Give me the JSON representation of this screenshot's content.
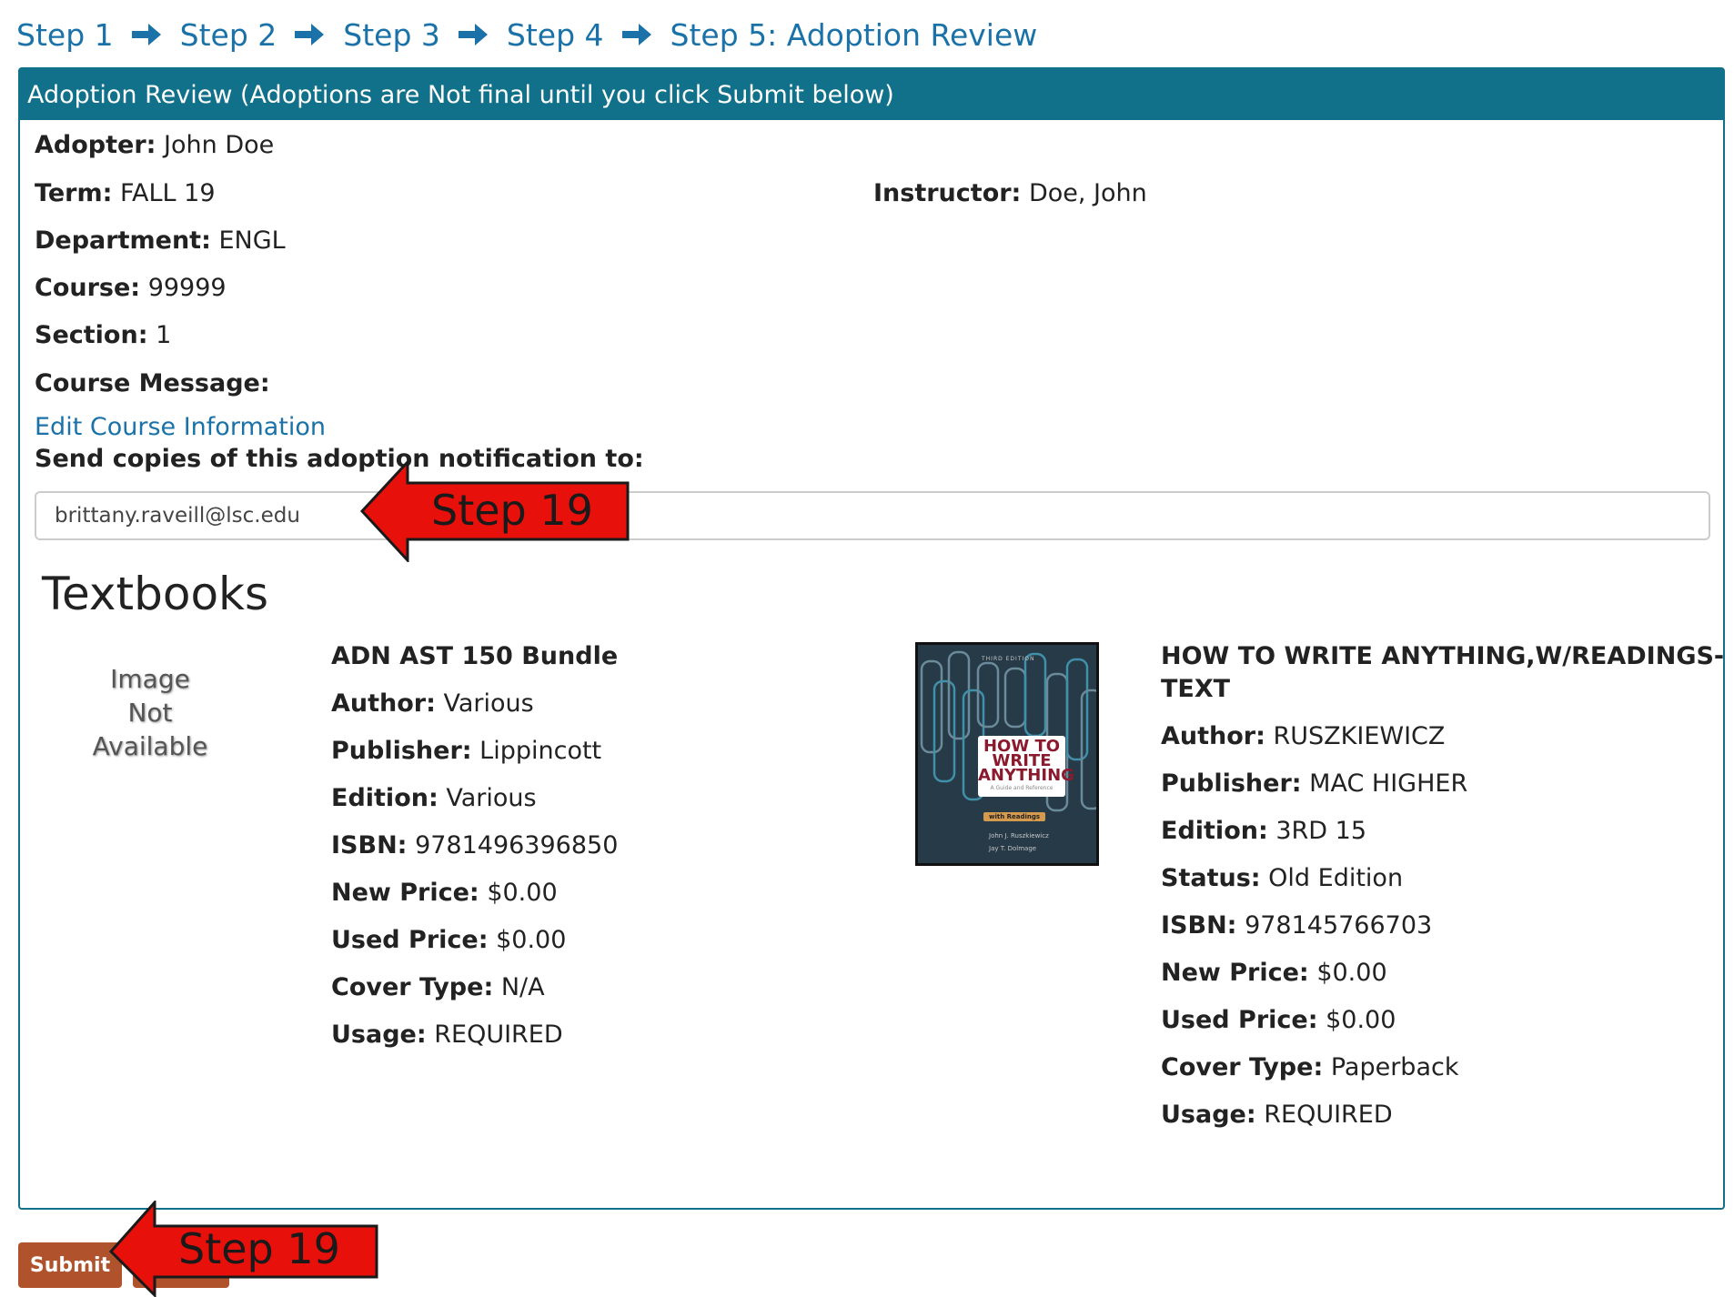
{
  "breadcrumb": {
    "steps": [
      "Step 1",
      "Step 2",
      "Step 3",
      "Step 4",
      "Step 5: Adoption Review"
    ]
  },
  "panel": {
    "heading": "Adoption Review (Adoptions are Not final until you click Submit below)"
  },
  "course": {
    "adopter_label": "Adopter:",
    "adopter": "John Doe",
    "term_label": "Term:",
    "term": "FALL 19",
    "instructor_label": "Instructor:",
    "instructor": "Doe, John",
    "department_label": "Department:",
    "department": "ENGL",
    "course_label": "Course:",
    "course": "99999",
    "section_label": "Section:",
    "section": "1",
    "message_label": "Course Message:",
    "message": "",
    "edit_link": "Edit Course Information"
  },
  "notification": {
    "label": "Send copies of this adoption notification to:",
    "email": "brittany.raveill@lsc.edu"
  },
  "textbooks": {
    "heading": "Textbooks",
    "items": [
      {
        "image_text": [
          "Image",
          "Not",
          "Available"
        ],
        "title": "ADN AST 150 Bundle",
        "fields": [
          {
            "label": "Author:",
            "value": "Various"
          },
          {
            "label": "Publisher:",
            "value": "Lippincott"
          },
          {
            "label": "Edition:",
            "value": "Various"
          },
          {
            "label": "ISBN:",
            "value": "9781496396850"
          },
          {
            "label": "New Price:",
            "value": "$0.00"
          },
          {
            "label": "Used Price:",
            "value": "$0.00"
          },
          {
            "label": "Cover Type:",
            "value": "N/A"
          },
          {
            "label": "Usage:",
            "value": "REQUIRED"
          }
        ]
      },
      {
        "cover": {
          "tag": "THIRD EDITION",
          "title": "HOW TO\nWRITE\nANYTHING",
          "subtitle": "A Guide and Reference",
          "badge": "with Readings",
          "authors": [
            "John J. Ruszkiewicz",
            "Jay T. Dolmage"
          ],
          "bg_color": "#263a48",
          "title_color": "#8b1a2e"
        },
        "title_lines": [
          "HOW TO WRITE ANYTHING,W/READINGS-",
          "TEXT"
        ],
        "fields": [
          {
            "label": "Author:",
            "value": "RUSZKIEWICZ"
          },
          {
            "label": "Publisher:",
            "value": "MAC HIGHER"
          },
          {
            "label": "Edition:",
            "value": "3RD 15"
          },
          {
            "label": "Status:",
            "value": "Old Edition"
          },
          {
            "label": "ISBN:",
            "value": "978145766703"
          },
          {
            "label": "New Price:",
            "value": "$0.00"
          },
          {
            "label": "Used Price:",
            "value": "$0.00"
          },
          {
            "label": "Cover Type:",
            "value": "Paperback"
          },
          {
            "label": "Usage:",
            "value": "REQUIRED"
          }
        ]
      }
    ]
  },
  "actions": {
    "submit_label": "Submit"
  },
  "annotations": {
    "email_arrow_text": "Step 19",
    "submit_arrow_text": "Step 19",
    "arrow_color": "#e8100a"
  },
  "colors": {
    "link": "#1a72a8",
    "panel_heading_bg": "#11708a",
    "submit_bg": "#b0532c"
  }
}
